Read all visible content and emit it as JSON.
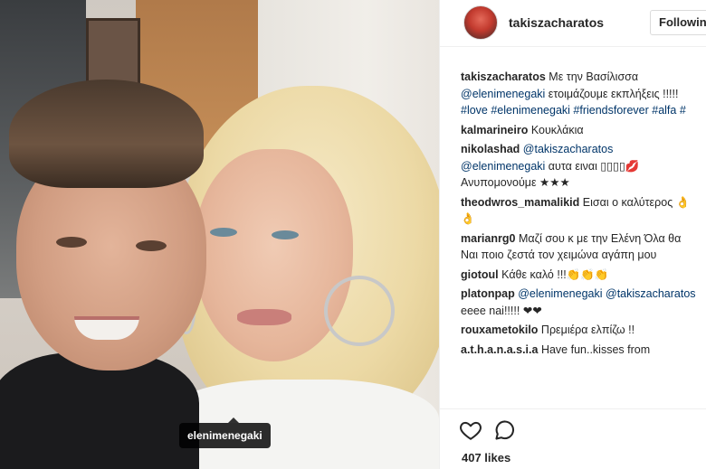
{
  "photo": {
    "tag_label": "elenimenegaki"
  },
  "header": {
    "username": "takiszacharatos",
    "follow_label": "Followin"
  },
  "caption": {
    "user": "takiszacharatos",
    "text_1": "Με την Βασίλισσα",
    "mention_1": "@elenimenegaki",
    "text_2": "ετοιμάζουμε εκπλήξεις !!!!!",
    "hashtags": "#love #elenimenegaki #friendsforever #alfa #"
  },
  "comments": [
    {
      "user": "kalmarineiro",
      "text": "Κουκλάκια"
    },
    {
      "user": "nikolashad",
      "mention_1": "@takiszacharatos",
      "mention_2": "@elenimenegaki",
      "text": "αυτα ειναι ▯▯▯▯💋 Ανυπομονούμε ★★★"
    },
    {
      "user": "theodwros_mamalikid",
      "text": "Εισαι ο καλύτερος 👌👌"
    },
    {
      "user": "marianrg0",
      "text": "Μαζί σου κ με την Ελένη Όλα θα Ναι ποιο ζεστά τον χειμώνα αγάπη μου"
    },
    {
      "user": "giotoul",
      "text": "Κάθε καλό !!!👏👏👏"
    },
    {
      "user": "platonpap",
      "mention_1": "@elenimenegaki",
      "mention_2": "@takiszacharatos",
      "text": "eeee nai!!!!! ❤❤"
    },
    {
      "user": "rouxametokilo",
      "text": "Πρεμιέρα ελπίζω !!"
    },
    {
      "user": "a.t.h.a.n.a.s.i.a",
      "text": "Have fun..kisses from"
    }
  ],
  "actions": {
    "like_icon": "heart-icon",
    "comment_icon": "comment-icon",
    "likes_text": "407 likes"
  },
  "colors": {
    "link": "#003569",
    "text": "#262626",
    "border": "#efefef"
  }
}
